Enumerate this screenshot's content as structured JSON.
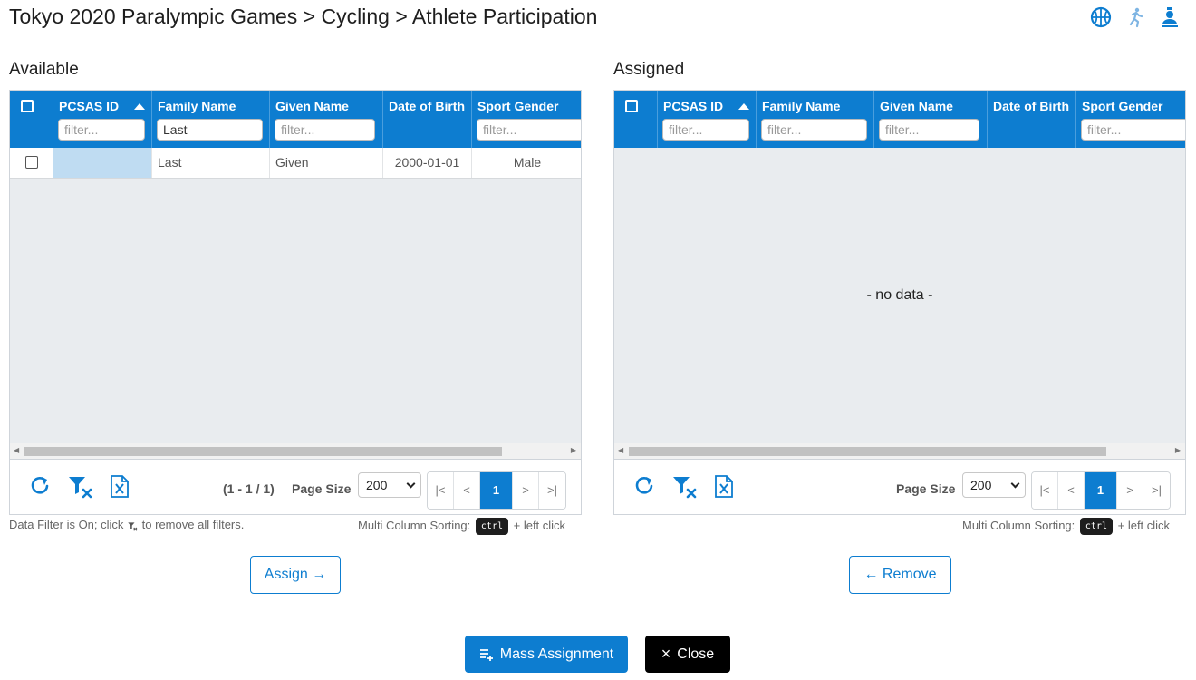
{
  "header": {
    "title": "Tokyo 2020 Paralympic Games > Cycling > Athlete Participation",
    "icons": [
      "basketball-icon",
      "running-athlete-icon",
      "user-profile-icon"
    ]
  },
  "colors": {
    "accent": "#0d7dd0",
    "highlight": "#bfdcf2",
    "close": "#000000"
  },
  "available": {
    "title": "Available",
    "columns": [
      {
        "label": "PCSAS ID",
        "filter": "",
        "placeholder": "filter...",
        "sorted": "asc"
      },
      {
        "label": "Family Name",
        "filter": "Last",
        "placeholder": "filter..."
      },
      {
        "label": "Given Name",
        "filter": "",
        "placeholder": "filter..."
      },
      {
        "label": "Date of Birth"
      },
      {
        "label": "Sport Gender",
        "filter": "",
        "placeholder": "filter..."
      }
    ],
    "rows": [
      {
        "pcsas_id": "",
        "family_name": "Last",
        "given_name": "Given",
        "dob": "2000-01-01",
        "sport_gender": "Male"
      }
    ],
    "count": "(1 - 1 / 1)",
    "page_size_label": "Page Size",
    "page_size": "200",
    "pager": [
      "|<",
      "<",
      "1",
      ">",
      ">|"
    ],
    "filter_note_pre": "Data Filter is On; click",
    "filter_note_post": "to remove all filters.",
    "sort_note_pre": "Multi Column Sorting:",
    "sort_note_key": "ctrl",
    "sort_note_post": "+ left click",
    "button": "Assign →"
  },
  "assigned": {
    "title": "Assigned",
    "columns": [
      {
        "label": "PCSAS ID",
        "filter": "",
        "placeholder": "filter...",
        "sorted": "asc"
      },
      {
        "label": "Family Name",
        "filter": "",
        "placeholder": "filter..."
      },
      {
        "label": "Given Name",
        "filter": "",
        "placeholder": "filter..."
      },
      {
        "label": "Date of Birth"
      },
      {
        "label": "Sport Gender",
        "filter": "",
        "placeholder": "filter..."
      }
    ],
    "empty_text": "- no data -",
    "page_size_label": "Page Size",
    "page_size": "200",
    "pager": [
      "|<",
      "<",
      "1",
      ">",
      ">|"
    ],
    "sort_note_pre": "Multi Column Sorting:",
    "sort_note_key": "ctrl",
    "sort_note_post": "+ left click",
    "button": "← Remove"
  },
  "footer": {
    "mass_assignment": "Mass Assignment",
    "close": "Close",
    "close_symbol": "×"
  }
}
